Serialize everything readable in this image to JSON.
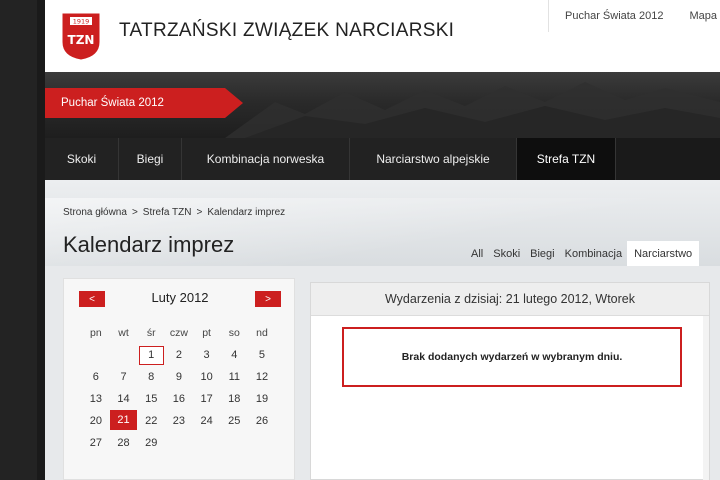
{
  "logo": {
    "year": "1919",
    "initials": "TZN"
  },
  "site_title": "TATRZAŃSKI ZWIĄZEK NARCIARSKI",
  "top_links": [
    "Puchar Świata 2012",
    "Mapa"
  ],
  "banner_tab": "Puchar Świata 2012",
  "main_nav": [
    {
      "label": "Skoki"
    },
    {
      "label": "Biegi"
    },
    {
      "label": "Kombinacja norweska"
    },
    {
      "label": "Narciarstwo alpejskie"
    },
    {
      "label": "Strefa TZN",
      "active": true
    }
  ],
  "breadcrumb": [
    "Strona główna",
    "Strefa TZN",
    "Kalendarz imprez"
  ],
  "breadcrumb_separator": ">",
  "page_title": "Kalendarz imprez",
  "filter_tabs": [
    "All",
    "Skoki",
    "Biegi",
    "Kombinacja",
    "Narciarstwo"
  ],
  "filter_active": "Narciarstwo",
  "calendar": {
    "month_label": "Luty 2012",
    "prev_label": "<",
    "next_label": ">",
    "weekdays": [
      "pn",
      "wt",
      "śr",
      "czw",
      "pt",
      "so",
      "nd"
    ],
    "weeks": [
      [
        "",
        "",
        "1",
        "2",
        "3",
        "4",
        "5"
      ],
      [
        "6",
        "7",
        "8",
        "9",
        "10",
        "11",
        "12"
      ],
      [
        "13",
        "14",
        "15",
        "16",
        "17",
        "18",
        "19"
      ],
      [
        "20",
        "21",
        "22",
        "23",
        "24",
        "25",
        "26"
      ],
      [
        "27",
        "28",
        "29",
        "",
        "",
        "",
        ""
      ]
    ],
    "today": "21",
    "boxed": "1"
  },
  "events": {
    "header": "Wydarzenia z dzisiaj: 21 lutego 2012, Wtorek",
    "empty_message": "Brak dodanych wydarzeń w wybranym dniu."
  },
  "colors": {
    "accent": "#cc1f1f",
    "dark_nav": "#1a1a1a",
    "content_bg": "#e7e9eb"
  }
}
